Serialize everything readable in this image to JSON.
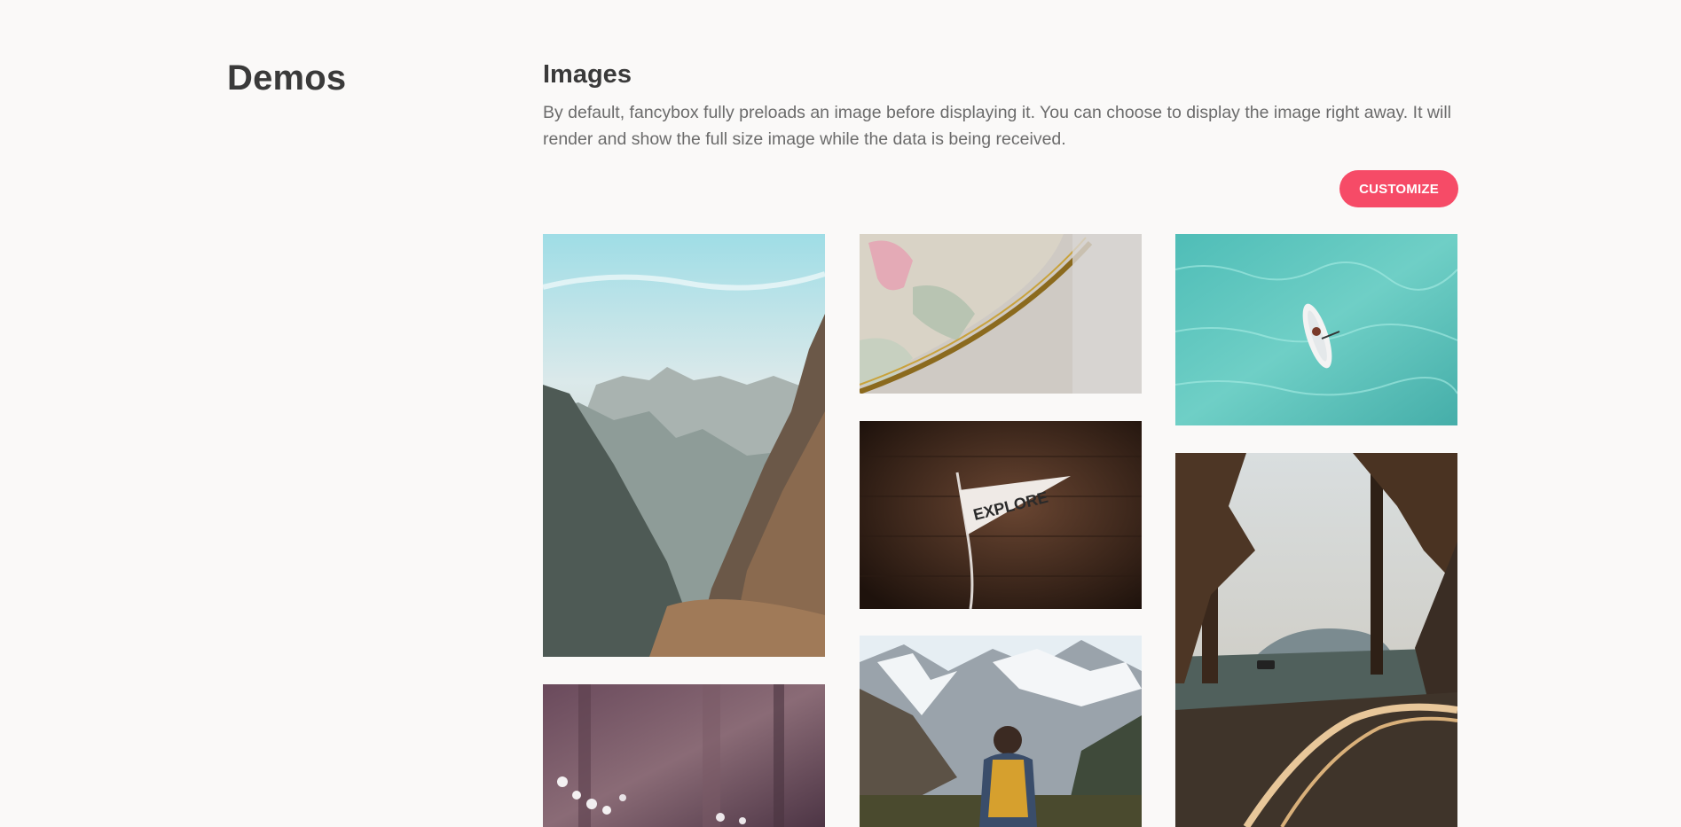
{
  "sidebar": {
    "title": "Demos"
  },
  "section": {
    "title": "Images",
    "description": "By default, fancybox fully preloads an image before displaying it. You can choose to display the image right away. It will render and show the full size image while the data is being received.",
    "customize_label": "CUSTOMIZE"
  },
  "theme": {
    "accent": "#f64b67",
    "background": "#faf9f8",
    "heading_color": "#3a3a3a",
    "text_color": "#6b6b6b"
  },
  "gallery": {
    "images": [
      {
        "name": "mountain-peaks-image",
        "subject": "rocky mountain ridge under blue sky"
      },
      {
        "name": "flower-forest-image",
        "subject": "white flowers in purple forest"
      },
      {
        "name": "globe-map-image",
        "subject": "close-up of a globe showing Southeast Asia"
      },
      {
        "name": "explore-pennant-image",
        "subject": "pennant flag on dark wooden wall",
        "text": "EXPLORE"
      },
      {
        "name": "hiker-mountains-image",
        "subject": "hiker with yellow backpack facing snowy mountains"
      },
      {
        "name": "paddleboard-water-image",
        "subject": "paddleboard on turquoise water"
      },
      {
        "name": "forest-road-image",
        "subject": "winding road through pine trees with a granite dome"
      }
    ]
  }
}
